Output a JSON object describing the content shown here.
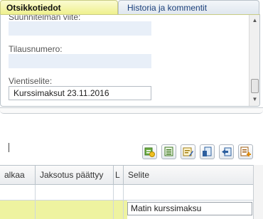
{
  "tabs": [
    {
      "label": "Otsikkotiedot",
      "active": true
    },
    {
      "label": "Historia ja kommentit",
      "active": false
    }
  ],
  "form": {
    "suunnitelman_viite_label": "Suunnitelman viite:",
    "tilausnumero_label": "Tilausnumero:",
    "vientiselite_label": "Vientiselite:",
    "vientiselite_value": "Kurssimaksut 23.11.2016"
  },
  "grid": {
    "headers": [
      "alkaa",
      "Jaksotus päättyy",
      "L",
      "Selite"
    ],
    "selite_value": "Matin kurssimaksu"
  },
  "toolbar_icons": [
    "add-row-icon",
    "copy-row-icon",
    "edit-row-icon",
    "split-row-icon",
    "import-row-icon",
    "add-dimension-icon"
  ],
  "colors": {
    "active_tab": "#eef08a",
    "selected_row": "#eef3a0",
    "field_bg": "#e8eff8"
  }
}
